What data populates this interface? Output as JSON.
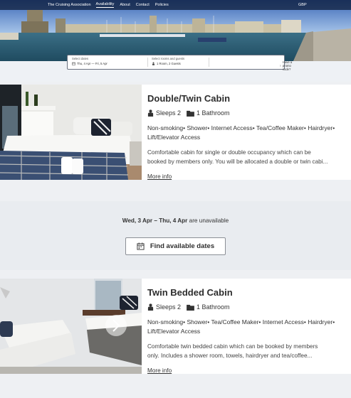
{
  "nav": {
    "brand": "The Cruising Association",
    "links": [
      "Availability",
      "About",
      "Contact",
      "Policies"
    ],
    "currency": "GBP"
  },
  "search": {
    "dates_label": "Select dates",
    "dates_value": "Thu, 4 Apr — Fri, 5 Apr",
    "rooms_label": "Select rooms and guests",
    "rooms_value": "1 Room, 2 Guests",
    "promo_label": "Have a promo code?"
  },
  "rooms": [
    {
      "title": "Double/Twin Cabin",
      "sleeps": "Sleeps 2",
      "bathrooms": "1 Bathroom",
      "amenities": [
        "Non-smoking",
        "Shower",
        "Internet Access",
        "Tea/Coffee Maker",
        "Hairdryer",
        "Lift/Elevator Access"
      ],
      "desc_line1": "Comfortable cabin for single or double occupancy which can be",
      "desc_line2": "booked by members only. You will be allocated a double or twin cabi...",
      "more": "More info"
    },
    {
      "title": "Twin Bedded Cabin",
      "sleeps": "Sleeps 2",
      "bathrooms": "1 Bathroom",
      "amenities": [
        "Non-smoking",
        "Shower",
        "Tea/Coffee Maker",
        "Internet Access",
        "Hairdryer",
        "Lift/Elevator Access"
      ],
      "desc_line1": "Comfortable twin bedded cabin which can be booked by members",
      "desc_line2": "only. Includes a shower room, towels, hairdryer and tea/coffee...",
      "more": "More info"
    }
  ],
  "unavailable": {
    "dates": "Wed, 3 Apr – Thu, 4 Apr",
    "suffix": "are unavailable",
    "button": "Find available dates"
  },
  "colors": {
    "nav_bg": "#0c1a34",
    "panel_bg": "#e9ecf0",
    "page_bg": "#eef0f3"
  }
}
